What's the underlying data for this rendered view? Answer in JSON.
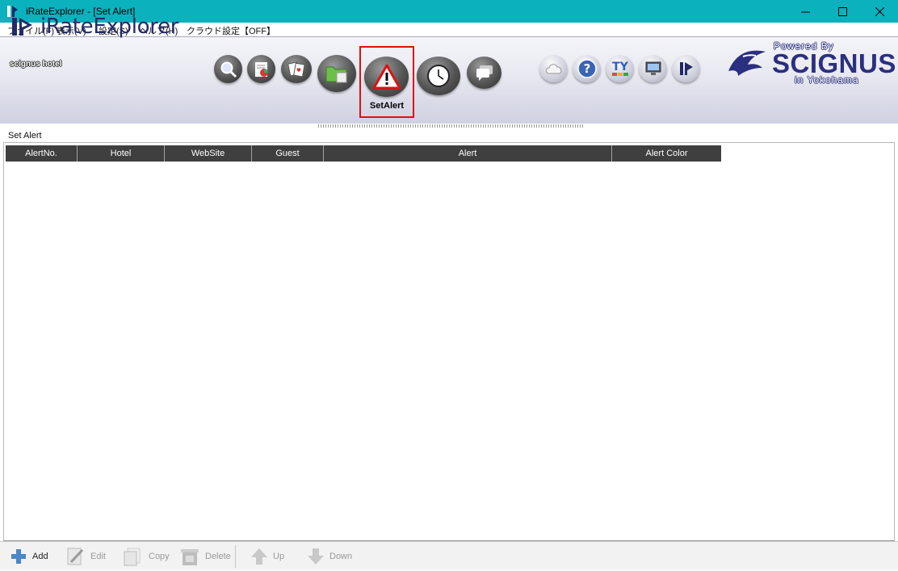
{
  "window": {
    "title": "iRateExplorer - [Set Alert]",
    "minimize": "—",
    "maximize": "☐",
    "close": "✕"
  },
  "menu": [
    "ファイル(F)",
    "表示(V)",
    "設定(S)",
    "ヘルプ(H)",
    "クラウド設定【OFF】"
  ],
  "banner": {
    "app_name": "iRateExplorer",
    "hotel": "scignus hotel",
    "active_tool_label": "SetAlert",
    "powered_by": "Powered By",
    "brand": "SCIGNUS",
    "brand_sub": "in Yokohama",
    "toolbar_icons": [
      "search-icon",
      "chart-report-icon",
      "cards-icon",
      "folder-icon",
      "alert-icon",
      "clock-icon",
      "chat-icon"
    ],
    "right_icons": [
      "cloud-icon",
      "help-icon",
      "ty-icon",
      "monitor-icon",
      "irate-logo-icon"
    ]
  },
  "section": {
    "title": "Set Alert"
  },
  "grid": {
    "columns": [
      "AlertNo.",
      "Hotel",
      "WebSite",
      "Guest",
      "Alert",
      "Alert Color"
    ],
    "rows": []
  },
  "actions": {
    "add": "Add",
    "edit": "Edit",
    "copy": "Copy",
    "delete": "Delete",
    "up": "Up",
    "down": "Down"
  },
  "colors": {
    "titlebar": "#0bb2bd",
    "grid_header": "#3f3f3f",
    "brand": "#2a2f7f",
    "highlight": "#e01010"
  }
}
